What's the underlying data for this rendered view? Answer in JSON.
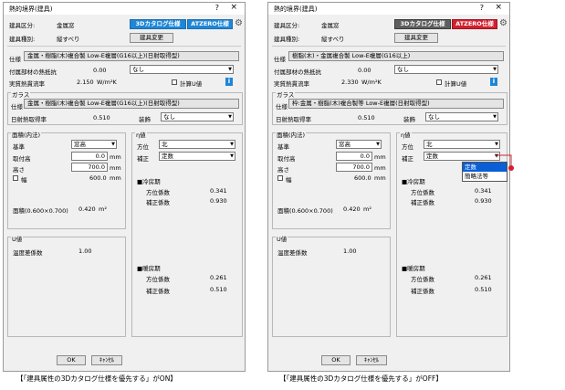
{
  "left": {
    "title": "熱的境界(建具)",
    "help": "?",
    "close": "×",
    "kubun_label": "建具区分:",
    "kubun_value": "金属窓",
    "catalog_btn": "3Dカタログ仕様",
    "atzero_btn": "ATZERO仕様",
    "shurui_label": "建具種別:",
    "shurui_value": "縦すべり",
    "change_btn": "建具変更",
    "shiyo_label": "仕様",
    "shiyo_value": "金属・樹脂(木)複合製 Low-E複層(G16以上)(日射取得型)",
    "fuzoku_label": "付属部材の熱抵抗",
    "fuzoku_value": "0.00",
    "fuzoku_select": "なし",
    "netsu_label": "実質熱貫流率",
    "netsu_value": "2.150",
    "netsu_unit": "W/m²K",
    "keisan_label": "計算U値",
    "glass_title": "ガラス",
    "glass_shiyo_label": "仕様",
    "glass_shiyo_value": "金属・樹脂(木)複合製 Low-E複層(G16以上)(日射取得型)",
    "nissha_label": "日射熱取得率",
    "nissha_value": "0.510",
    "soshoku_label": "装飾",
    "soshoku_value": "なし",
    "menseki_title": "面積(内法)",
    "kijun_label": "基準",
    "kijun_value": "窓高",
    "toritsuke_label": "取付高",
    "toritsuke_value": "0.0",
    "toritsuke_unit": "mm",
    "takasa_label": "高さ",
    "takasa_value": "700.0",
    "takasa_unit": "mm",
    "haba_label": "幅",
    "haba_value": "600.0",
    "haba_unit": "mm",
    "area_label": "面積(0.600×0.700)",
    "area_value": "0.420",
    "area_unit": "m²",
    "u_title": "U値",
    "ondo_label": "温度差係数",
    "ondo_value": "1.00",
    "eta_title": "η値",
    "hoi_label": "方位",
    "hoi_value": "北",
    "hosei_label": "補正",
    "hosei_value": "定数",
    "reibo_title": "■冷房期",
    "reibo_hoi_label": "方位係数",
    "reibo_hoi_value": "0.341",
    "reibo_hosei_label": "補正係数",
    "reibo_hosei_value": "0.930",
    "danbo_title": "■暖房期",
    "danbo_hoi_label": "方位係数",
    "danbo_hoi_value": "0.261",
    "danbo_hosei_label": "補正係数",
    "danbo_hosei_value": "0.510",
    "ok": "OK",
    "cancel": "ｷｬﾝｾﾙ"
  },
  "right": {
    "title": "熱的境界(建具)",
    "help": "?",
    "close": "×",
    "kubun_label": "建具区分:",
    "kubun_value": "金属窓",
    "catalog_btn": "3Dカタログ仕様",
    "atzero_btn": "ATZERO仕様",
    "shurui_label": "建具種別:",
    "shurui_value": "縦すべり",
    "change_btn": "建具変更",
    "shiyo_label": "仕様",
    "shiyo_value": "樹脂(木)・金属複合製 Low-E複層(G16以上)",
    "fuzoku_label": "付属部材の熱抵抗",
    "fuzoku_value": "0.00",
    "fuzoku_select": "なし",
    "netsu_label": "実質熱貫流率",
    "netsu_value": "2.330",
    "netsu_unit": "W/m²K",
    "keisan_label": "計算U値",
    "glass_title": "ガラス",
    "glass_shiyo_label": "仕様",
    "glass_shiyo_value": "枠:金属・樹脂(木)複合製等 Low-E複層(日射取得型)",
    "nissha_label": "日射熱取得率",
    "nissha_value": "0.510",
    "soshoku_label": "装飾",
    "soshoku_value": "なし",
    "menseki_title": "面積(内法)",
    "kijun_label": "基準",
    "kijun_value": "窓高",
    "toritsuke_label": "取付高",
    "toritsuke_value": "0.0",
    "toritsuke_unit": "mm",
    "takasa_label": "高さ",
    "takasa_value": "700.0",
    "takasa_unit": "mm",
    "haba_label": "幅",
    "haba_value": "600.0",
    "haba_unit": "mm",
    "area_label": "面積(0.600×0.700)",
    "area_value": "0.420",
    "area_unit": "m²",
    "u_title": "U値",
    "ondo_label": "温度差係数",
    "ondo_value": "1.00",
    "eta_title": "η値",
    "hoi_label": "方位",
    "hoi_value": "北",
    "hosei_label": "補正",
    "hosei_value": "定数",
    "dropdown_options": [
      "定数",
      "簡略法等"
    ],
    "reibo_title": "■冷房期",
    "reibo_hoi_label": "方位係数",
    "reibo_hoi_value": "0.341",
    "reibo_hosei_label": "補正係数",
    "reibo_hosei_value": "0.930",
    "danbo_title": "■暖房期",
    "danbo_hoi_label": "方位係数",
    "danbo_hoi_value": "0.261",
    "danbo_hosei_label": "補正係数",
    "danbo_hosei_value": "0.510",
    "ok": "OK",
    "cancel": "ｷｬﾝｾﾙ"
  },
  "captions": {
    "left": "【「建具属性の3Dカタログ仕様を優先する」がON】",
    "right": "【「建具属性の3Dカタログ仕様を優先する」がOFF】"
  },
  "colors": {
    "catalog_on": "#1e86d6",
    "catalog_off": "#5e5e5e",
    "atzero_on": "#d2202f",
    "callout": "#d2202f"
  },
  "icons": [
    "gear-icon",
    "info-icon",
    "checkbox-icon",
    "dropdown-arrow-icon"
  ]
}
